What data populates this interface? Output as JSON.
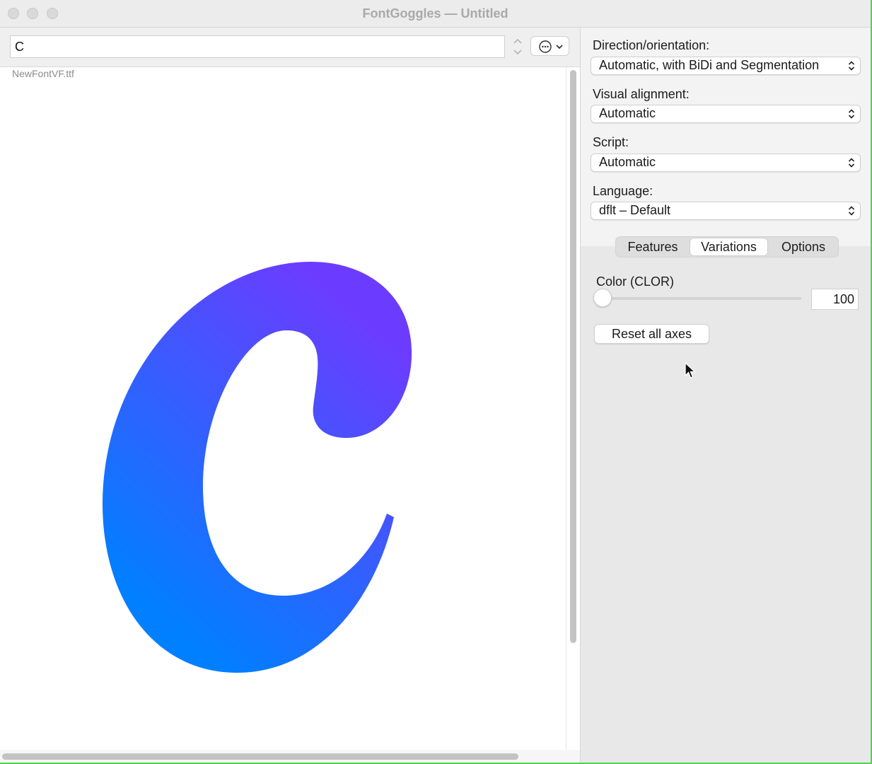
{
  "window": {
    "title": "FontGoggles — Untitled"
  },
  "toolbar": {
    "text_value": "C",
    "action_icon": "ellipsis-circle-icon"
  },
  "preview": {
    "font_file": "NewFontVF.ttf",
    "glyph": "C",
    "gradient": {
      "start": "#6b3cff",
      "end": "#0080ff"
    }
  },
  "settings": {
    "direction": {
      "label": "Direction/orientation:",
      "value": "Automatic, with BiDi and Segmentation"
    },
    "alignment": {
      "label": "Visual alignment:",
      "value": "Automatic"
    },
    "script": {
      "label": "Script:",
      "value": "Automatic"
    },
    "language": {
      "label": "Language:",
      "value": "dflt – Default"
    }
  },
  "tabs": [
    {
      "label": "Features",
      "active": false
    },
    {
      "label": "Variations",
      "active": true
    },
    {
      "label": "Options",
      "active": false
    }
  ],
  "variations": {
    "axis_label": "Color (CLOR)",
    "axis_value": "100",
    "slider_fraction": 0.0,
    "reset_label": "Reset all axes"
  },
  "colors": {
    "window_border": "#4fd34f",
    "panel_bg": "#e8e8e8"
  }
}
